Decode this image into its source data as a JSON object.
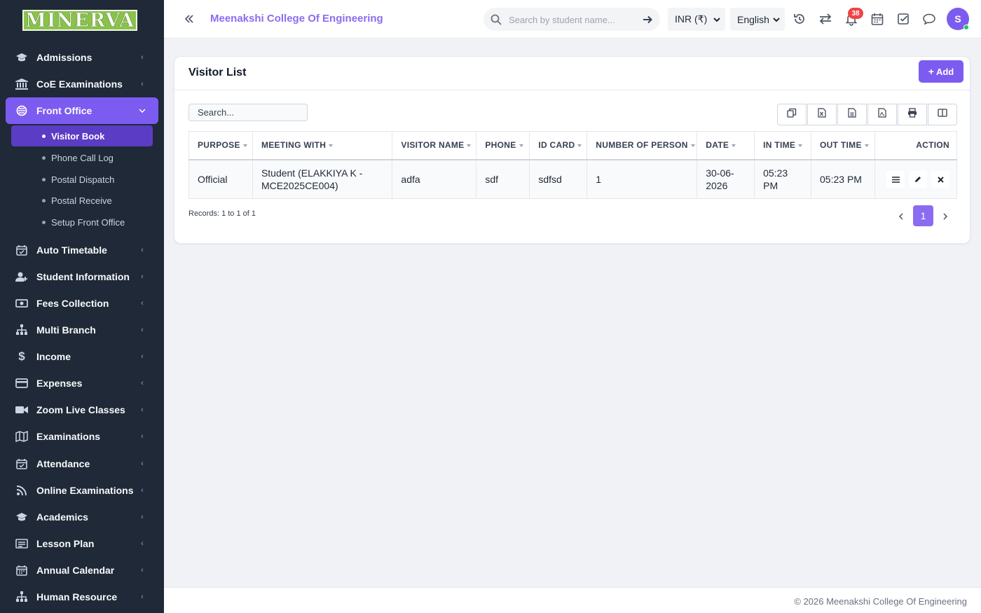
{
  "brand": {
    "logo_text": "MINERVA"
  },
  "sidebar": {
    "items": [
      {
        "label": "Admissions",
        "icon": "graduation-cap-icon"
      },
      {
        "label": "CoE Examinations",
        "icon": "institution-icon"
      },
      {
        "label": "Front Office",
        "icon": "front-office-icon",
        "active": true
      },
      {
        "label": "Auto Timetable",
        "icon": "calendar-check-icon"
      },
      {
        "label": "Student Information",
        "icon": "user-add-icon"
      },
      {
        "label": "Fees Collection",
        "icon": "money-icon"
      },
      {
        "label": "Multi Branch",
        "icon": "sitemap-icon"
      },
      {
        "label": "Income",
        "icon": "dollar-icon"
      },
      {
        "label": "Expenses",
        "icon": "credit-card-icon"
      },
      {
        "label": "Zoom Live Classes",
        "icon": "video-icon"
      },
      {
        "label": "Examinations",
        "icon": "map-icon"
      },
      {
        "label": "Attendance",
        "icon": "calendar-check-icon"
      },
      {
        "label": "Online Examinations",
        "icon": "rss-icon"
      },
      {
        "label": "Academics",
        "icon": "graduation-cap-icon"
      },
      {
        "label": "Lesson Plan",
        "icon": "list-alt-icon"
      },
      {
        "label": "Annual Calendar",
        "icon": "calendar-icon"
      },
      {
        "label": "Human Resource",
        "icon": "sitemap-icon"
      }
    ],
    "sub_items": [
      {
        "label": "Visitor Book",
        "active": true
      },
      {
        "label": "Phone Call Log"
      },
      {
        "label": "Postal Dispatch"
      },
      {
        "label": "Postal Receive"
      },
      {
        "label": "Setup Front Office"
      }
    ]
  },
  "header": {
    "college_name": "Meenakshi College Of Engineering",
    "search_placeholder": "Search by student name...",
    "currency": "INR (₹)",
    "language": "English",
    "notification_count": "38",
    "avatar_initial": "S"
  },
  "card": {
    "title": "Visitor List",
    "add_label": "Add",
    "search_placeholder": "Search...",
    "toolbar": [
      "copy-icon",
      "excel-icon",
      "csv-icon",
      "pdf-icon",
      "print-icon",
      "columns-icon"
    ],
    "columns": [
      "PURPOSE",
      "MEETING WITH",
      "VISITOR NAME",
      "PHONE",
      "ID CARD",
      "NUMBER OF PERSON",
      "DATE",
      "IN TIME",
      "OUT TIME",
      "ACTION"
    ],
    "rows": [
      {
        "purpose": "Official",
        "meeting_with": "Student (ELAKKIYA K - MCE2025CE004)",
        "visitor_name": "adfa",
        "phone": "sdf",
        "id_card": "sdfsd",
        "number_of_person": "1",
        "date": "30-06-2026",
        "in_time": "05:23 PM",
        "out_time": "05:23 PM"
      }
    ],
    "records_text": "Records: 1 to 1 of 1",
    "current_page": "1"
  },
  "footer": {
    "text": "© 2026 Meenakshi College Of Engineering"
  },
  "colors": {
    "accent": "#7c5cf0",
    "sidebar_bg": "#1f2937",
    "badge": "#ef4444"
  }
}
